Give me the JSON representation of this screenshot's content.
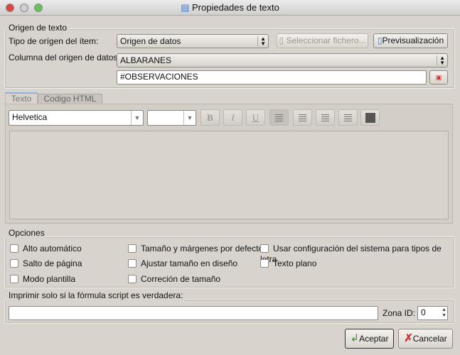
{
  "window": {
    "title": "Propiedades de texto"
  },
  "origin": {
    "group_label": "Origen de texto",
    "type_label": "Tipo de orígen del ítem:",
    "type_value": "Origen de datos",
    "select_file": "Seleccionar fichero...",
    "preview": "Previsualización",
    "column_label": "Columna del origen de datos:",
    "column_value": "ALBARANES",
    "field_value": "#OBSERVACIONES"
  },
  "tabs": [
    {
      "label": "Texto"
    },
    {
      "label": "Codigo HTML"
    }
  ],
  "editor": {
    "font": "Helvetica",
    "size": "",
    "bold": "B",
    "italic": "I",
    "underline": "U"
  },
  "options": {
    "group_label": "Opciones",
    "items": [
      "Alto automático",
      "Salto de página",
      "Modo plantilla",
      "Tamaño y márgenes por defecto",
      "Ajustar tamaño en diseño",
      "Correción de tamaño",
      "Usar configuración del sistema para tipos de letra",
      "Texto plano"
    ]
  },
  "print": {
    "group_label": "Imprimir solo si la fórmula script es verdadera:",
    "formula": "",
    "zone_label": "Zona ID:",
    "zone_value": "0"
  },
  "buttons": {
    "accept": "Aceptar",
    "cancel": "Cancelar"
  }
}
